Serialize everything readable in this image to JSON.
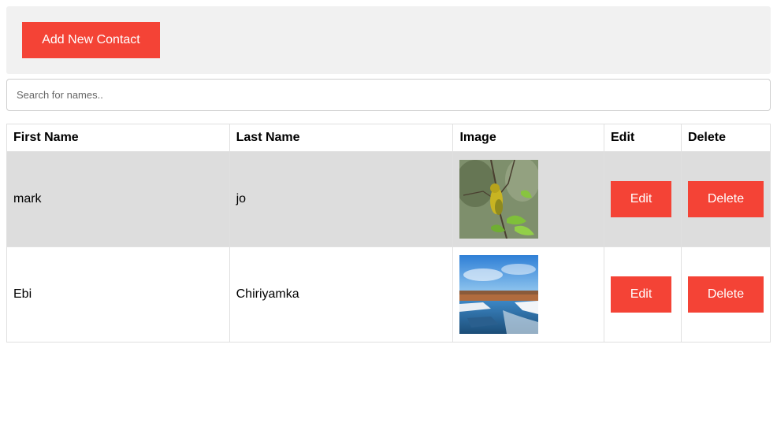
{
  "header": {
    "add_button_label": "Add New Contact"
  },
  "search": {
    "placeholder": "Search for names..",
    "value": ""
  },
  "table": {
    "columns": [
      "First Name",
      "Last Name",
      "Image",
      "Edit",
      "Delete"
    ],
    "rows": [
      {
        "first_name": "mark",
        "last_name": "jo",
        "image": "bird-photo",
        "edit_label": "Edit",
        "delete_label": "Delete"
      },
      {
        "first_name": "Ebi",
        "last_name": "Chiriyamka",
        "image": "river-landscape-photo",
        "edit_label": "Edit",
        "delete_label": "Delete"
      }
    ]
  },
  "colors": {
    "accent": "#f44336",
    "topbar_bg": "#f1f1f1",
    "row_shade": "#dddddd"
  }
}
